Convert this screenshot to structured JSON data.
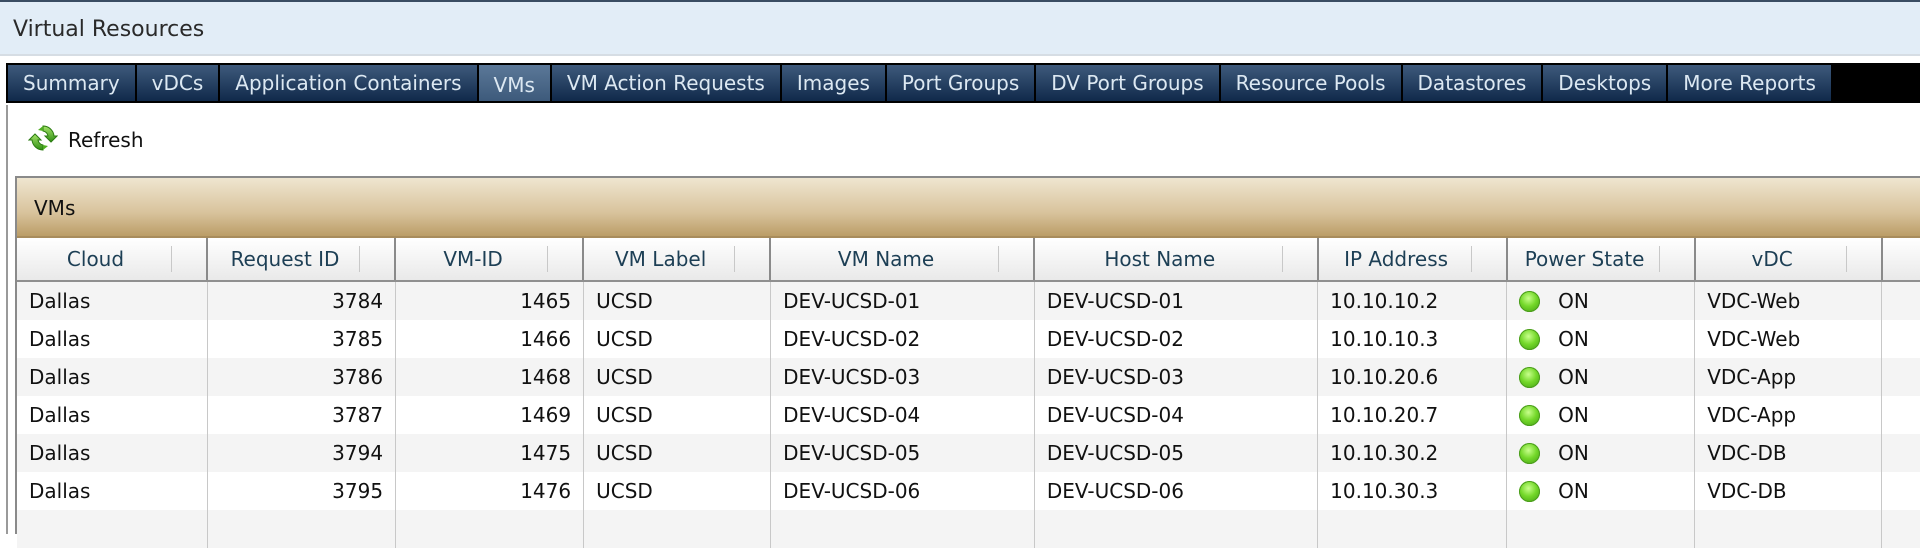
{
  "window": {
    "title": "Virtual Resources"
  },
  "tabs": [
    {
      "label": "Summary",
      "active": false
    },
    {
      "label": "vDCs",
      "active": false
    },
    {
      "label": "Application Containers",
      "active": false
    },
    {
      "label": "VMs",
      "active": true
    },
    {
      "label": "VM Action Requests",
      "active": false
    },
    {
      "label": "Images",
      "active": false
    },
    {
      "label": "Port Groups",
      "active": false
    },
    {
      "label": "DV Port Groups",
      "active": false
    },
    {
      "label": "Resource Pools",
      "active": false
    },
    {
      "label": "Datastores",
      "active": false
    },
    {
      "label": "Desktops",
      "active": false
    },
    {
      "label": "More Reports",
      "active": false
    }
  ],
  "toolbar": {
    "refresh_label": "Refresh",
    "refresh_icon": "refresh-icon"
  },
  "panel": {
    "title": "VMs"
  },
  "table": {
    "columns": [
      "Cloud",
      "Request ID",
      "VM-ID",
      "VM Label",
      "VM Name",
      "Host Name",
      "IP Address",
      "Power State",
      "vDC",
      ""
    ],
    "rows": [
      [
        "Dallas",
        "3784",
        "1465",
        "UCSD",
        "DEV-UCSD-01",
        "DEV-UCSD-01",
        "10.10.10.2",
        "ON",
        "VDC-Web",
        ""
      ],
      [
        "Dallas",
        "3785",
        "1466",
        "UCSD",
        "DEV-UCSD-02",
        "DEV-UCSD-02",
        "10.10.10.3",
        "ON",
        "VDC-Web",
        ""
      ],
      [
        "Dallas",
        "3786",
        "1468",
        "UCSD",
        "DEV-UCSD-03",
        "DEV-UCSD-03",
        "10.10.20.6",
        "ON",
        "VDC-App",
        ""
      ],
      [
        "Dallas",
        "3787",
        "1469",
        "UCSD",
        "DEV-UCSD-04",
        "DEV-UCSD-04",
        "10.10.20.7",
        "ON",
        "VDC-App",
        ""
      ],
      [
        "Dallas",
        "3794",
        "1475",
        "UCSD",
        "DEV-UCSD-05",
        "DEV-UCSD-05",
        "10.10.30.2",
        "ON",
        "VDC-DB",
        ""
      ],
      [
        "Dallas",
        "3795",
        "1476",
        "UCSD",
        "DEV-UCSD-06",
        "DEV-UCSD-06",
        "10.10.30.3",
        "ON",
        "VDC-DB",
        ""
      ]
    ],
    "power_on_color": "#6cd22a"
  },
  "colors": {
    "tab_bg": "#1b355a",
    "tab_active_bg": "#4d6a8b",
    "panel_header": "#c9ad7c",
    "title_bar_bg": "#e2edf7"
  }
}
